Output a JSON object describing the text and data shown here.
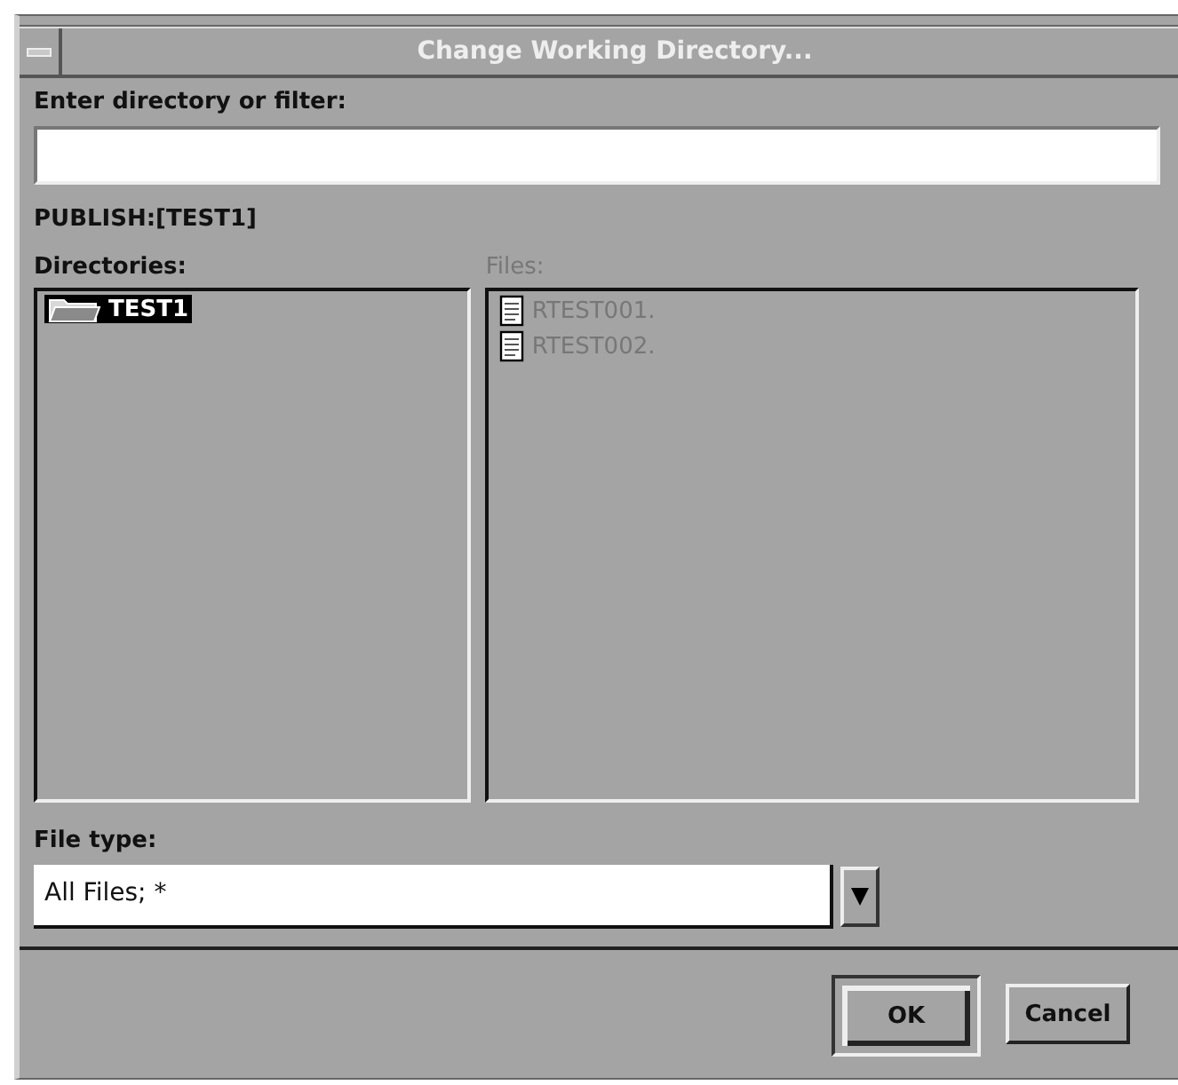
{
  "window": {
    "title": "Change Working Directory..."
  },
  "filter": {
    "label": "Enter directory or filter:"
  },
  "current_path": "PUBLISH:[TEST1]",
  "directories": {
    "label": "Directories:",
    "items": [
      {
        "name": "TEST1",
        "selected": true
      }
    ]
  },
  "files": {
    "label": "Files:",
    "disabled": true,
    "items": [
      {
        "name": "RTEST001.",
        "selected": false
      },
      {
        "name": "RTEST002.",
        "selected": false
      }
    ]
  },
  "file_type": {
    "label": "File type:",
    "value": "All Files; *"
  },
  "buttons": [
    {
      "label": "OK",
      "default": true
    },
    {
      "label": "Cancel",
      "default": false
    }
  ]
}
